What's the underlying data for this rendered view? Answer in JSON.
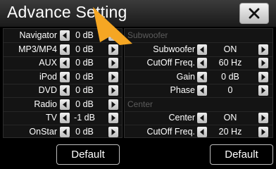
{
  "title": "Advance Setting",
  "close_icon": "close-x-icon",
  "left_rows": [
    {
      "label": "Navigator",
      "value": "0 dB"
    },
    {
      "label": "MP3/MP4",
      "value": "0 dB"
    },
    {
      "label": "AUX",
      "value": "0 dB"
    },
    {
      "label": "iPod",
      "value": "0 dB"
    },
    {
      "label": "DVD",
      "value": "0 dB"
    },
    {
      "label": "Radio",
      "value": "0 dB"
    },
    {
      "label": "TV",
      "value": "-1 dB"
    },
    {
      "label": "OnStar",
      "value": "0 dB"
    }
  ],
  "subwoofer_section": "Subwoofer",
  "subwoofer_rows": [
    {
      "label": "Subwoofer",
      "value": "ON"
    },
    {
      "label": "CutOff Freq.",
      "value": "60 Hz"
    },
    {
      "label": "Gain",
      "value": "0 dB"
    },
    {
      "label": "Phase",
      "value": "0"
    }
  ],
  "center_section": "Center",
  "center_rows": [
    {
      "label": "Center",
      "value": "ON"
    },
    {
      "label": "CutOff Freq.",
      "value": "20 Hz"
    }
  ],
  "default_left_label": "Default",
  "default_right_label": "Default",
  "colors": {
    "pointer": "#f5a623",
    "section_text": "#5c5c5c"
  }
}
